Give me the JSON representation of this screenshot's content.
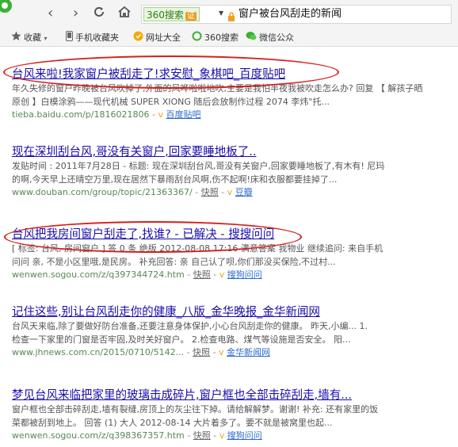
{
  "browser": {
    "search_engine": "360搜索",
    "cert_badge": "证",
    "query": "窗户被台风刮走的新闻"
  },
  "bookmarks": [
    {
      "label": "收藏",
      "icon": "star-icon"
    },
    {
      "label": "手机收藏夹",
      "icon": "phone-icon"
    },
    {
      "label": "网址大全",
      "icon": "globe-icon"
    },
    {
      "label": "360搜索",
      "icon": "search-360-icon"
    },
    {
      "label": "微信公众",
      "icon": "wechat-icon"
    }
  ],
  "results": [
    {
      "title": "台风来啦!我家窗户被刮走了!求安慰_象棋吧_百度贴吧",
      "lines": [
        "年久失修的窗户昨晚被台风吹掉了,外面的风哗啦啦地吹,主要是我怕半夜我被吹走怎么办? 回复 【 解孩子晒",
        "原创 】白模涂鸦——现代机械 SUPER XIONG 随后会放制作过程 2074 李炜\"托..."
      ],
      "url": "tieba.baidu.com/p/1816021806",
      "source": "百度贴吧",
      "snapshot": ""
    },
    {
      "title": "现在深圳刮台风,哥没有关窗户,回家要睡地板了..",
      "lines": [
        "发贴时间 : 2011年7月28日 - 标题: 现在深圳刮台风,哥没有关窗户,回家要睡地板了,有木有! 尼玛",
        "的啊,今天早上还晴空万里,现在居然下暴雨刮台风啊,伤不起啊!床和衣服都要挂掉了..."
      ],
      "url": "www.douban.com/group/topic/21363367/",
      "source": "豆瓣",
      "snapshot": "快照"
    },
    {
      "title": "台风把我房间窗户刮走了,找谁? - 已解决 - 搜搜问问",
      "lines": [
        "[ 标签: 台风, 房间窗户 ] 答 0 条 绝版 2012-08-08 17:16 满意答案 我物业 继续追问: 来自手机",
        "问问 亲, 不是小区里哦,是民房。 补充回答: 亲 自己认了呗,你们那没买保险,不过村..."
      ],
      "url": "wenwen.sogou.com/z/q397344724.htm",
      "source": "搜狗问问",
      "snapshot": "快照"
    },
    {
      "title": "记住这些,别让台风刮走你的健康_八版_金华晚报_金华新闻网",
      "lines": [
        "台风天来临,除了要做好防台准备,还要注意身体保护,小心台风刮走你的健康。 昨天,小编... 1.",
        "检查一下家里的门窗是否牢固,及时关好窗户。 2.检查电路、煤气等设施是否安全。 阳..."
      ],
      "url": "www.jhnews.com.cn/2015/0710/5142...",
      "source": "金华新闻网",
      "snapshot": "快照"
    },
    {
      "title": "梦见台风来临把家里的玻璃击成碎片,窗户框也全部击碎刮走,墙有...",
      "lines": [
        "窗户框也全部击碎刮走,墙有裂缝,房顶上的灰尘往下掉。请给解解梦。谢谢! 补充: 还有家里的饭",
        "菜都被刮到地上。 回答 (1) 大人 2012-08-14 大片着多了。要不就是被窝里也起..."
      ],
      "url": "wenwen.sogou.com/z/q398367357.htm",
      "source": "搜狗问问",
      "snapshot": "快照"
    }
  ]
}
